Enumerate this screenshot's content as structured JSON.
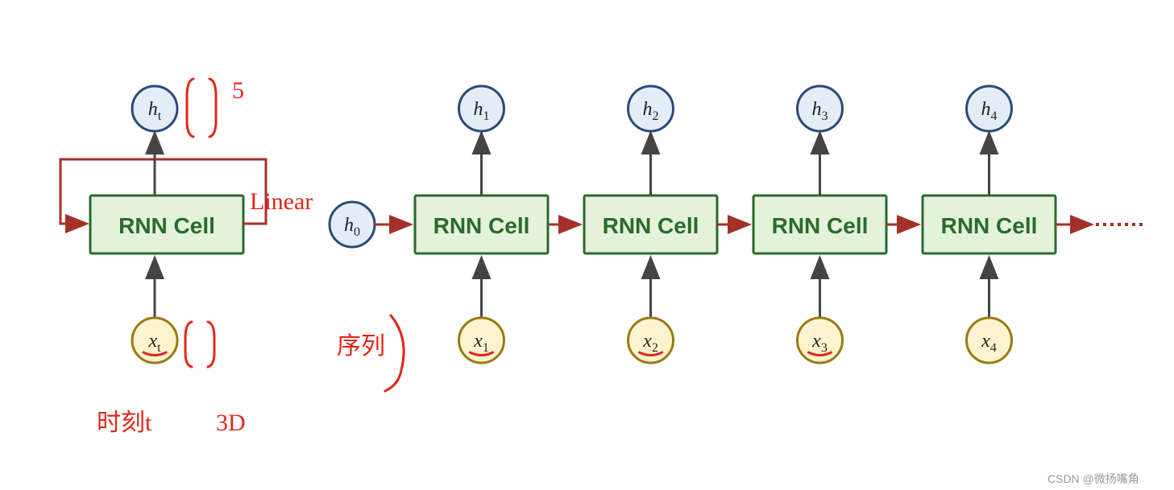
{
  "diagram": {
    "cell_label": "RNN Cell",
    "compact": {
      "h": "h",
      "h_sub": "t",
      "x": "x",
      "x_sub": "t"
    },
    "h0": {
      "label": "h",
      "sub": "0"
    },
    "unrolled": [
      {
        "h": "h",
        "h_sub": "1",
        "x": "x",
        "x_sub": "1"
      },
      {
        "h": "h",
        "h_sub": "2",
        "x": "x",
        "x_sub": "2"
      },
      {
        "h": "h",
        "h_sub": "3",
        "x": "x",
        "x_sub": "3"
      },
      {
        "h": "h",
        "h_sub": "4",
        "x": "x",
        "x_sub": "4"
      }
    ]
  },
  "annotations": {
    "five": "5",
    "linear": "Linear",
    "seq": "序列",
    "time": "时刻t",
    "threeD": "3D"
  },
  "watermark": "CSDN @微扬嘴角"
}
